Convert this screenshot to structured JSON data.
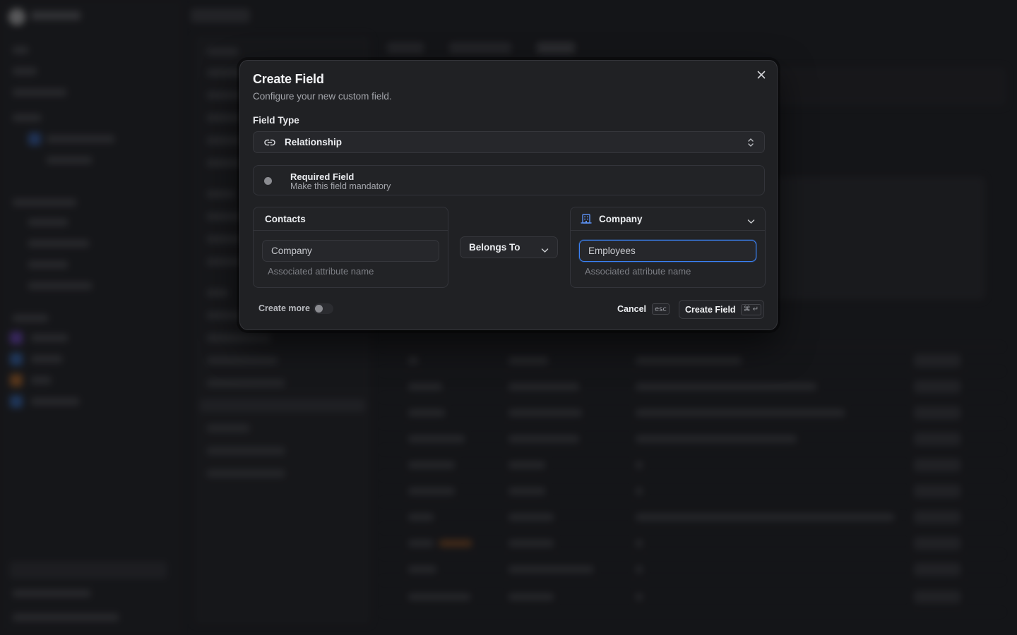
{
  "dialog": {
    "title": "Create Field",
    "subtitle": "Configure your new custom field.",
    "field_type_label": "Field Type",
    "field_type_value": "Relationship",
    "required": {
      "title": "Required Field",
      "subtitle": "Make this field mandatory",
      "checked": false
    },
    "relation": {
      "left_entity": "Contacts",
      "left_attribute_value": "Company",
      "left_hint": "Associated attribute name",
      "relation_type": "Belongs To",
      "right_entity": "Company",
      "right_attribute_value": "Employees",
      "right_hint": "Associated attribute name"
    },
    "footer": {
      "create_more_label": "Create more",
      "create_more_on": false,
      "cancel_label": "Cancel",
      "cancel_shortcut": "esc",
      "create_label": "Create Field",
      "create_shortcut": "⌘ ↵"
    }
  },
  "icons": {
    "close": "close-icon",
    "field_type": "link-icon",
    "select_arrows": "chevron-updown-icon",
    "right_entity": "building-icon",
    "dropdown": "chevron-down-icon"
  },
  "colors": {
    "focus_ring": "#3b82f6",
    "dialog_bg": "#202124"
  }
}
